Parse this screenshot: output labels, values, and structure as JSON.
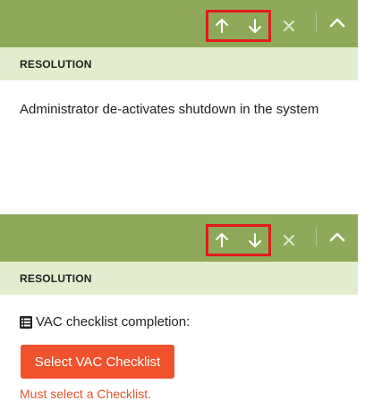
{
  "colors": {
    "toolbar_bg": "#8ea95a",
    "section_header_bg": "#e2ecce",
    "highlight_box": "#e01b1b",
    "primary_button": "#f0522d",
    "error_text": "#e2552c"
  },
  "icons": {
    "move_up": "arrow-up-icon",
    "move_down": "arrow-down-icon",
    "remove": "close-icon",
    "collapse": "chevron-up-icon",
    "checklist": "list-icon"
  },
  "card1": {
    "section_title": "RESOLUTION",
    "resolution_text": "Administrator de-activates shutdown in the system"
  },
  "card2": {
    "section_title": "RESOLUTION",
    "checklist_label": "VAC checklist completion:",
    "select_button_label": "Select VAC Checklist",
    "error_message": "Must select a Checklist."
  }
}
